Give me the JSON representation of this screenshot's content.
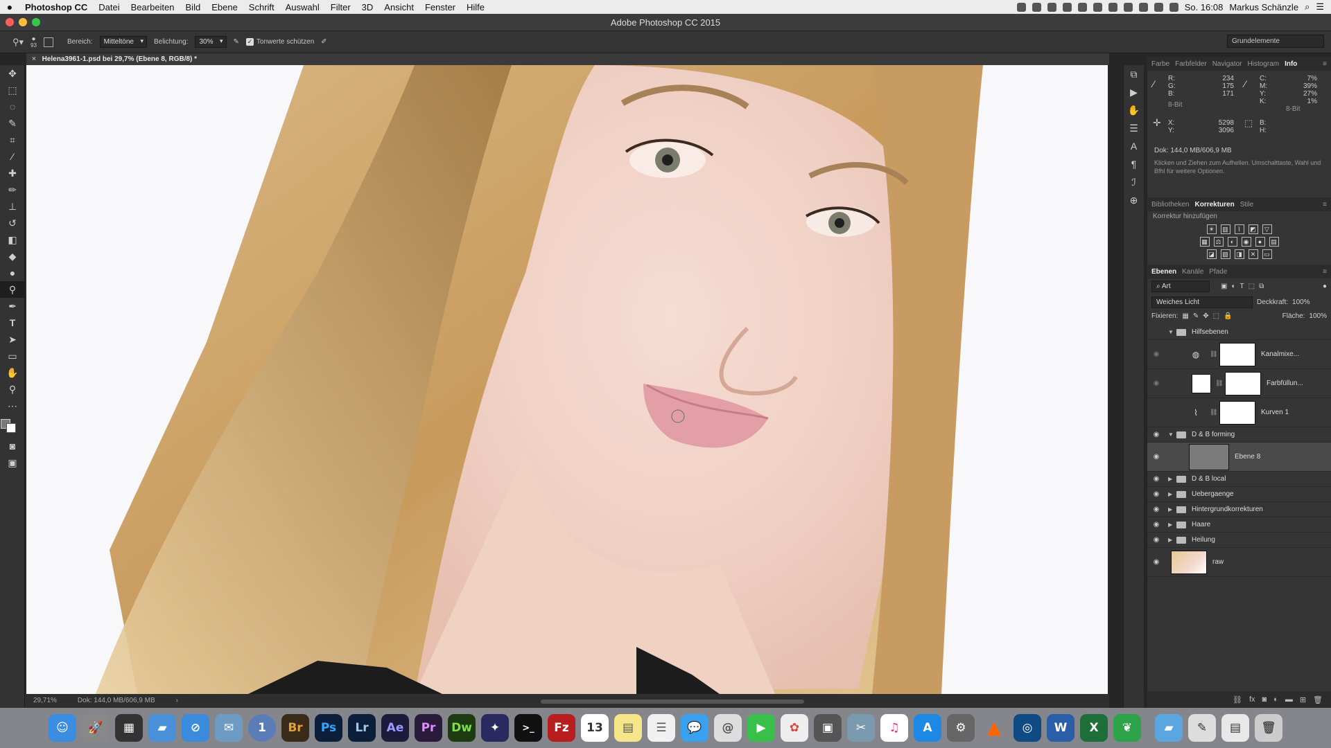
{
  "menubar": {
    "apple": "",
    "app": "Photoshop CC",
    "items": [
      "Datei",
      "Bearbeiten",
      "Bild",
      "Ebene",
      "Schrift",
      "Auswahl",
      "Filter",
      "3D",
      "Ansicht",
      "Fenster",
      "Hilfe"
    ],
    "clock": "So. 16:08",
    "user": "Markus Schänzle"
  },
  "window": {
    "title": "Adobe Photoshop CC 2015"
  },
  "options": {
    "brush_size": "93",
    "range_label": "Bereich:",
    "range_value": "Mitteltöne",
    "exposure_label": "Belichtung:",
    "exposure_value": "30%",
    "protect_label": "Tonwerte schützen",
    "workspace": "Grundelemente"
  },
  "document": {
    "tab": "Helena3961-1.psd bei 29,7% (Ebene 8, RGB/8) *",
    "zoom": "29,71%",
    "doc_info": "Dok: 144,0 MB/606,9 MB"
  },
  "info_panel": {
    "tabs": [
      "Farbe",
      "Farbfelder",
      "Navigator",
      "Histogram",
      "Info"
    ],
    "r": "R:",
    "g": "G:",
    "b": "B:",
    "r_val": "234",
    "g_val": "175",
    "b_val": "171",
    "bit1": "8-Bit",
    "c": "C:",
    "m": "M:",
    "y": "Y:",
    "k": "K:",
    "c_val": "7%",
    "m_val": "39%",
    "y_val": "27%",
    "k_val": "1%",
    "bit2": "8-Bit",
    "x": "X:",
    "yc": "Y:",
    "x_val": "5298",
    "y_val2": "3096",
    "bw": "B:",
    "h": "H:",
    "doc": "Dok: 144,0 MB/606,9 MB",
    "hint": "Klicken und Ziehen zum Aufhellen. Umschalttaste, Wahl und Bfhl für weitere Optionen."
  },
  "adjustments": {
    "tabs": [
      "Bibliotheken",
      "Korrekturen",
      "Stile"
    ],
    "heading": "Korrektur hinzufügen"
  },
  "layers_panel": {
    "tabs": [
      "Ebenen",
      "Kanäle",
      "Pfade"
    ],
    "filter": "Art",
    "blend": "Weiches Licht",
    "opacity_label": "Deckkraft:",
    "opacity": "100%",
    "lock_label": "Fixieren:",
    "fill_label": "Fläche:",
    "fill": "100%",
    "layers": [
      {
        "name": "Hilfsebenen"
      },
      {
        "name": "Kanalmixe..."
      },
      {
        "name": "Farbfüllun..."
      },
      {
        "name": "Kurven 1"
      },
      {
        "name": "D & B forming"
      },
      {
        "name": "Ebene 8"
      },
      {
        "name": "D & B local"
      },
      {
        "name": "Uebergaenge"
      },
      {
        "name": "Hintergrundkorrekturen"
      },
      {
        "name": "Haare"
      },
      {
        "name": "Heilung"
      },
      {
        "name": "raw"
      }
    ]
  },
  "dock": [
    "Br",
    "Ps",
    "Lr",
    "Ae",
    "Pr",
    "Dw",
    "13",
    "W",
    "X"
  ]
}
